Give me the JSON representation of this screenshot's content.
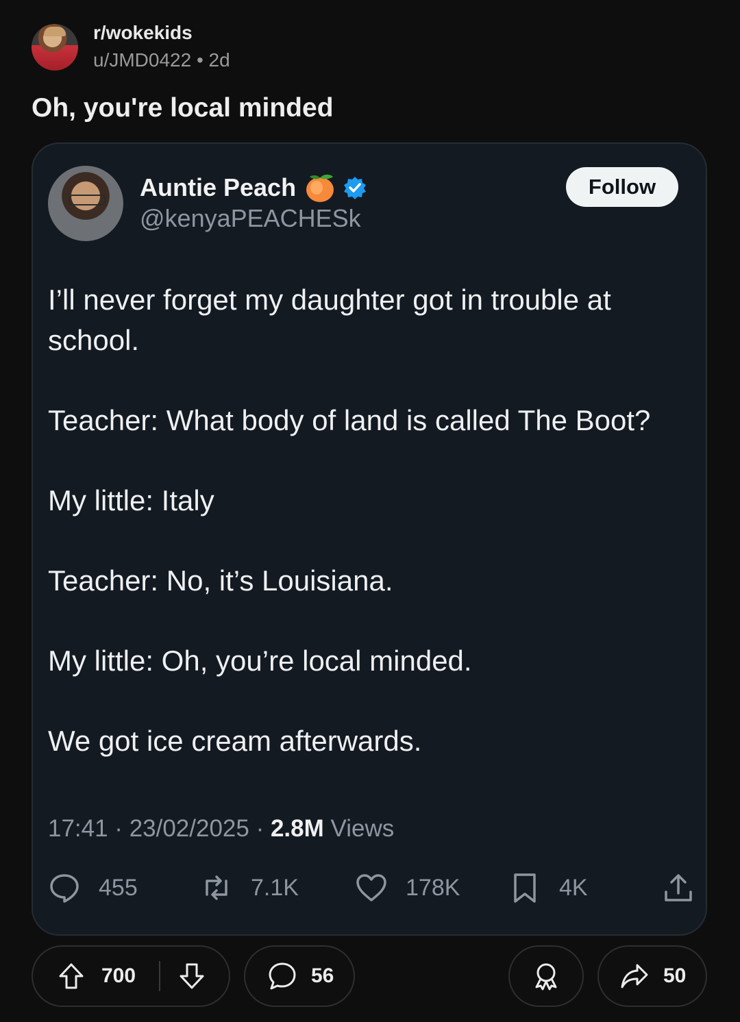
{
  "reddit_post": {
    "subreddit": "r/wokekids",
    "user_time": "u/JMD0422 • 2d",
    "title": "Oh, you're local minded"
  },
  "tweet": {
    "display_name": "Auntie Peach",
    "handle": "@kenyaPEACHESk",
    "follow_label": "Follow",
    "paragraphs": [
      "I’ll never forget my daughter got in trouble at school.",
      "Teacher: What body of land is called The Boot?",
      "My little: Italy",
      "Teacher: No, it’s Louisiana.",
      "My little: Oh, you’re local minded.",
      "We got ice cream afterwards."
    ],
    "timestamp": "17:41 · 23/02/2025 · ",
    "views_count": "2.8M",
    "views_label": " Views",
    "stats": {
      "replies": "455",
      "reposts": "7.1K",
      "likes": "178K",
      "bookmarks": "4K"
    }
  },
  "actions_bar": {
    "upvotes": "700",
    "comments": "56",
    "shares": "50"
  },
  "colors": {
    "page_bg": "#0e0e0e",
    "card_bg": "#141a22",
    "verified_blue": "#1d9bf0",
    "muted_text": "#8e96a0"
  }
}
